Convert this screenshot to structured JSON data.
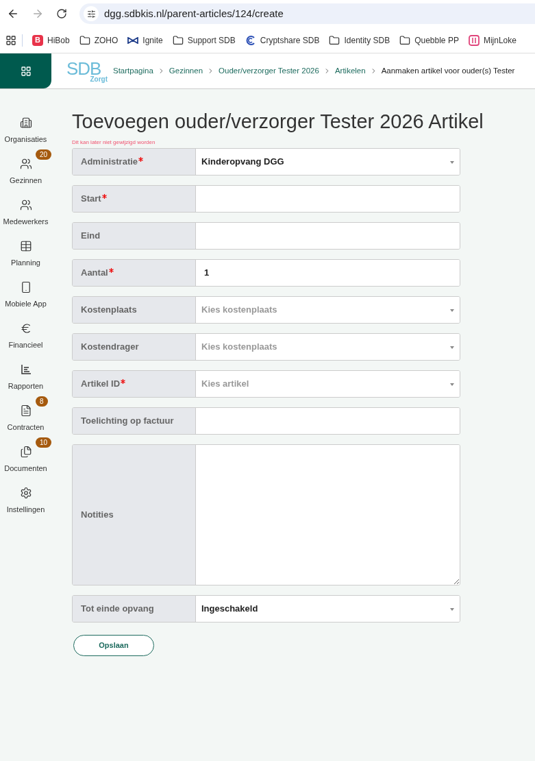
{
  "browser": {
    "url": "dgg.sdbkis.nl/parent-articles/124/create",
    "bookmarks": [
      {
        "kind": "letter",
        "badge": "B",
        "label": "HiBob"
      },
      {
        "kind": "folder",
        "label": "ZOHO"
      },
      {
        "kind": "bowtie",
        "label": "Ignite"
      },
      {
        "kind": "folder",
        "label": "Support SDB"
      },
      {
        "kind": "ring",
        "label": "Cryptshare SDB"
      },
      {
        "kind": "folder",
        "label": "Identity SDB"
      },
      {
        "kind": "folder",
        "label": "Quebble PP"
      },
      {
        "kind": "square",
        "label": "MijnLoke"
      }
    ]
  },
  "header": {
    "logo": {
      "main": "SDB",
      "sub": "Zorgt"
    },
    "breadcrumbs": [
      {
        "label": "Startpagina",
        "current": false
      },
      {
        "label": "Gezinnen",
        "current": false
      },
      {
        "label": "Ouder/verzorger Tester 2026",
        "current": false
      },
      {
        "label": "Artikelen",
        "current": false
      },
      {
        "label": "Aanmaken artikel voor ouder(s) Tester",
        "current": true
      }
    ]
  },
  "sidebar": {
    "items": [
      {
        "kind": "building",
        "label": "Organisaties"
      },
      {
        "kind": "family",
        "label": "Gezinnen",
        "badge": "20"
      },
      {
        "kind": "team",
        "label": "Medewerkers"
      },
      {
        "kind": "table",
        "label": "Planning"
      },
      {
        "kind": "phone",
        "label": "Mobiele App"
      },
      {
        "kind": "euro",
        "label": "Financieel"
      },
      {
        "kind": "report",
        "label": "Rapporten"
      },
      {
        "kind": "contract",
        "label": "Contracten",
        "badge": "8"
      },
      {
        "kind": "files",
        "label": "Documenten",
        "badge": "10"
      },
      {
        "kind": "gear",
        "label": "Instellingen"
      }
    ]
  },
  "page": {
    "title": "Toevoegen ouder/verzorger Tester 2026 Artikel",
    "warning": "Dit kan later niet gewijzigd worden",
    "fields": [
      {
        "kind": "select",
        "label": "Administratie",
        "required": true,
        "value": "Kinderopvang DGG"
      },
      {
        "kind": "input",
        "label": "Start",
        "required": true
      },
      {
        "kind": "input",
        "label": "Eind",
        "required": false
      },
      {
        "kind": "input",
        "label": "Aantal",
        "required": true,
        "value": "1"
      },
      {
        "kind": "select",
        "label": "Kostenplaats",
        "required": false,
        "placeholder": "Kies kostenplaats"
      },
      {
        "kind": "select",
        "label": "Kostendrager",
        "required": false,
        "placeholder": "Kies kostenplaats"
      },
      {
        "kind": "select",
        "label": "Artikel ID",
        "required": true,
        "placeholder": "Kies artikel"
      },
      {
        "kind": "input",
        "label": "Toelichting op factuur",
        "required": false
      },
      {
        "kind": "textarea",
        "label": "Notities",
        "required": false
      },
      {
        "kind": "select",
        "label": "Tot einde opvang",
        "required": false,
        "value": "Ingeschakeld"
      }
    ],
    "save_button": "Opslaan"
  }
}
